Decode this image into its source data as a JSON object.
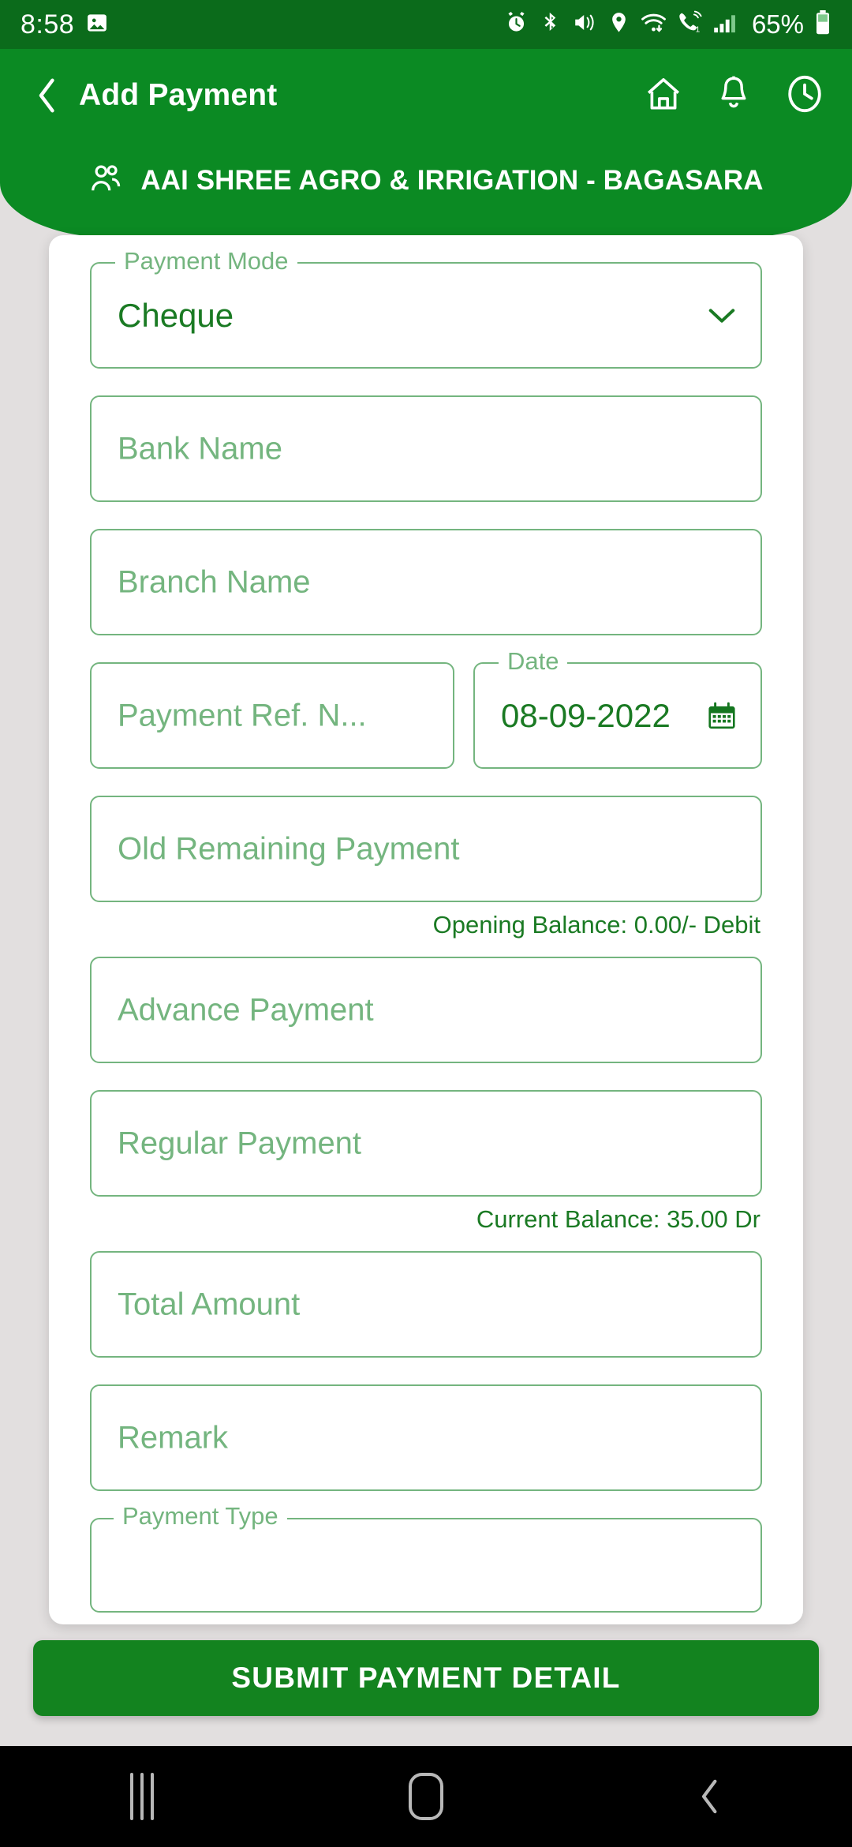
{
  "theme": {
    "status_bar_bg": "#0b6b1b",
    "header_green": "#0b8a23",
    "field_border": "#74b57f",
    "placeholder_green": "#74b57f",
    "value_green": "#1a7a23",
    "submit_green": "#13831f",
    "card_bg": "#ffffff",
    "page_bg": "#e2dfdf",
    "navbar_bg": "#000000"
  },
  "status_bar": {
    "time": "8:58",
    "battery_percent": "65%",
    "left_icons": [
      "image-icon"
    ],
    "right_icons": [
      "alarm-icon",
      "bluetooth-icon",
      "mute-vibrate-icon",
      "location-icon",
      "wifi-icon",
      "call-icon",
      "signal-bars-icon",
      "battery-icon"
    ]
  },
  "appbar": {
    "back_icon": "chevron-left-icon",
    "title": "Add Payment",
    "actions": [
      {
        "name": "home-icon",
        "label": "Home"
      },
      {
        "name": "bell-icon",
        "label": "Notifications"
      },
      {
        "name": "clock-icon",
        "label": "History"
      }
    ]
  },
  "customer": {
    "icon": "people-icon",
    "name": "AAI SHREE AGRO & IRRIGATION - BAGASARA"
  },
  "form": {
    "payment_mode": {
      "label": "Payment Mode",
      "value": "Cheque",
      "trailing_icon": "chevron-down-icon",
      "options": [
        "Cheque"
      ]
    },
    "bank_name": {
      "placeholder": "Bank Name",
      "value": ""
    },
    "branch_name": {
      "placeholder": "Branch Name",
      "value": ""
    },
    "payment_ref_no": {
      "placeholder": "Payment Ref. N...",
      "value": ""
    },
    "date": {
      "label": "Date",
      "value": "08-09-2022",
      "trailing_icon": "calendar-icon"
    },
    "old_remaining_payment": {
      "placeholder": "Old Remaining Payment",
      "value": "",
      "helper": "Opening Balance: 0.00/- Debit"
    },
    "advance_payment": {
      "placeholder": "Advance Payment",
      "value": ""
    },
    "regular_payment": {
      "placeholder": "Regular Payment",
      "value": "",
      "helper": "Current Balance: 35.00 Dr"
    },
    "total_amount": {
      "placeholder": "Total Amount",
      "value": ""
    },
    "remark": {
      "placeholder": "Remark",
      "value": ""
    },
    "payment_type": {
      "label": "Payment Type",
      "value": ""
    }
  },
  "submit": {
    "label": "SUBMIT PAYMENT DETAIL"
  },
  "nav_bar": {
    "recents_icon": "recents-bars-icon",
    "home_icon": "home-square-icon",
    "back_icon": "back-chevron-icon"
  }
}
